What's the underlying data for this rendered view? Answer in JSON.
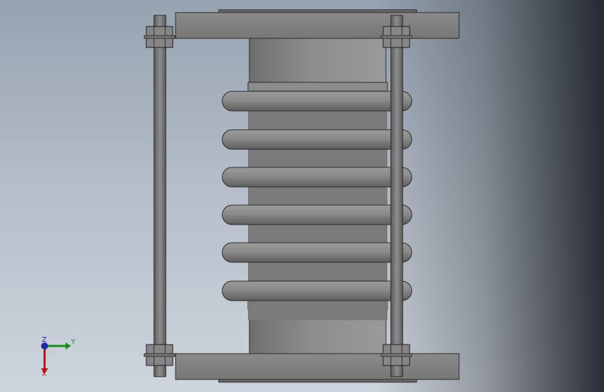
{
  "scene": {
    "background_top": "#97a3b1",
    "background_bottom": "#cfd5de",
    "metal_light": "#a9a9a9",
    "metal_mid": "#7d7d7d",
    "metal_dark": "#4a4a4a"
  },
  "triad": {
    "labels": {
      "z": "Z",
      "y": "Y",
      "x": "X"
    },
    "colors": {
      "z": "#1f2aa8",
      "y": "#1a8a1a",
      "x": "#b01515"
    }
  }
}
